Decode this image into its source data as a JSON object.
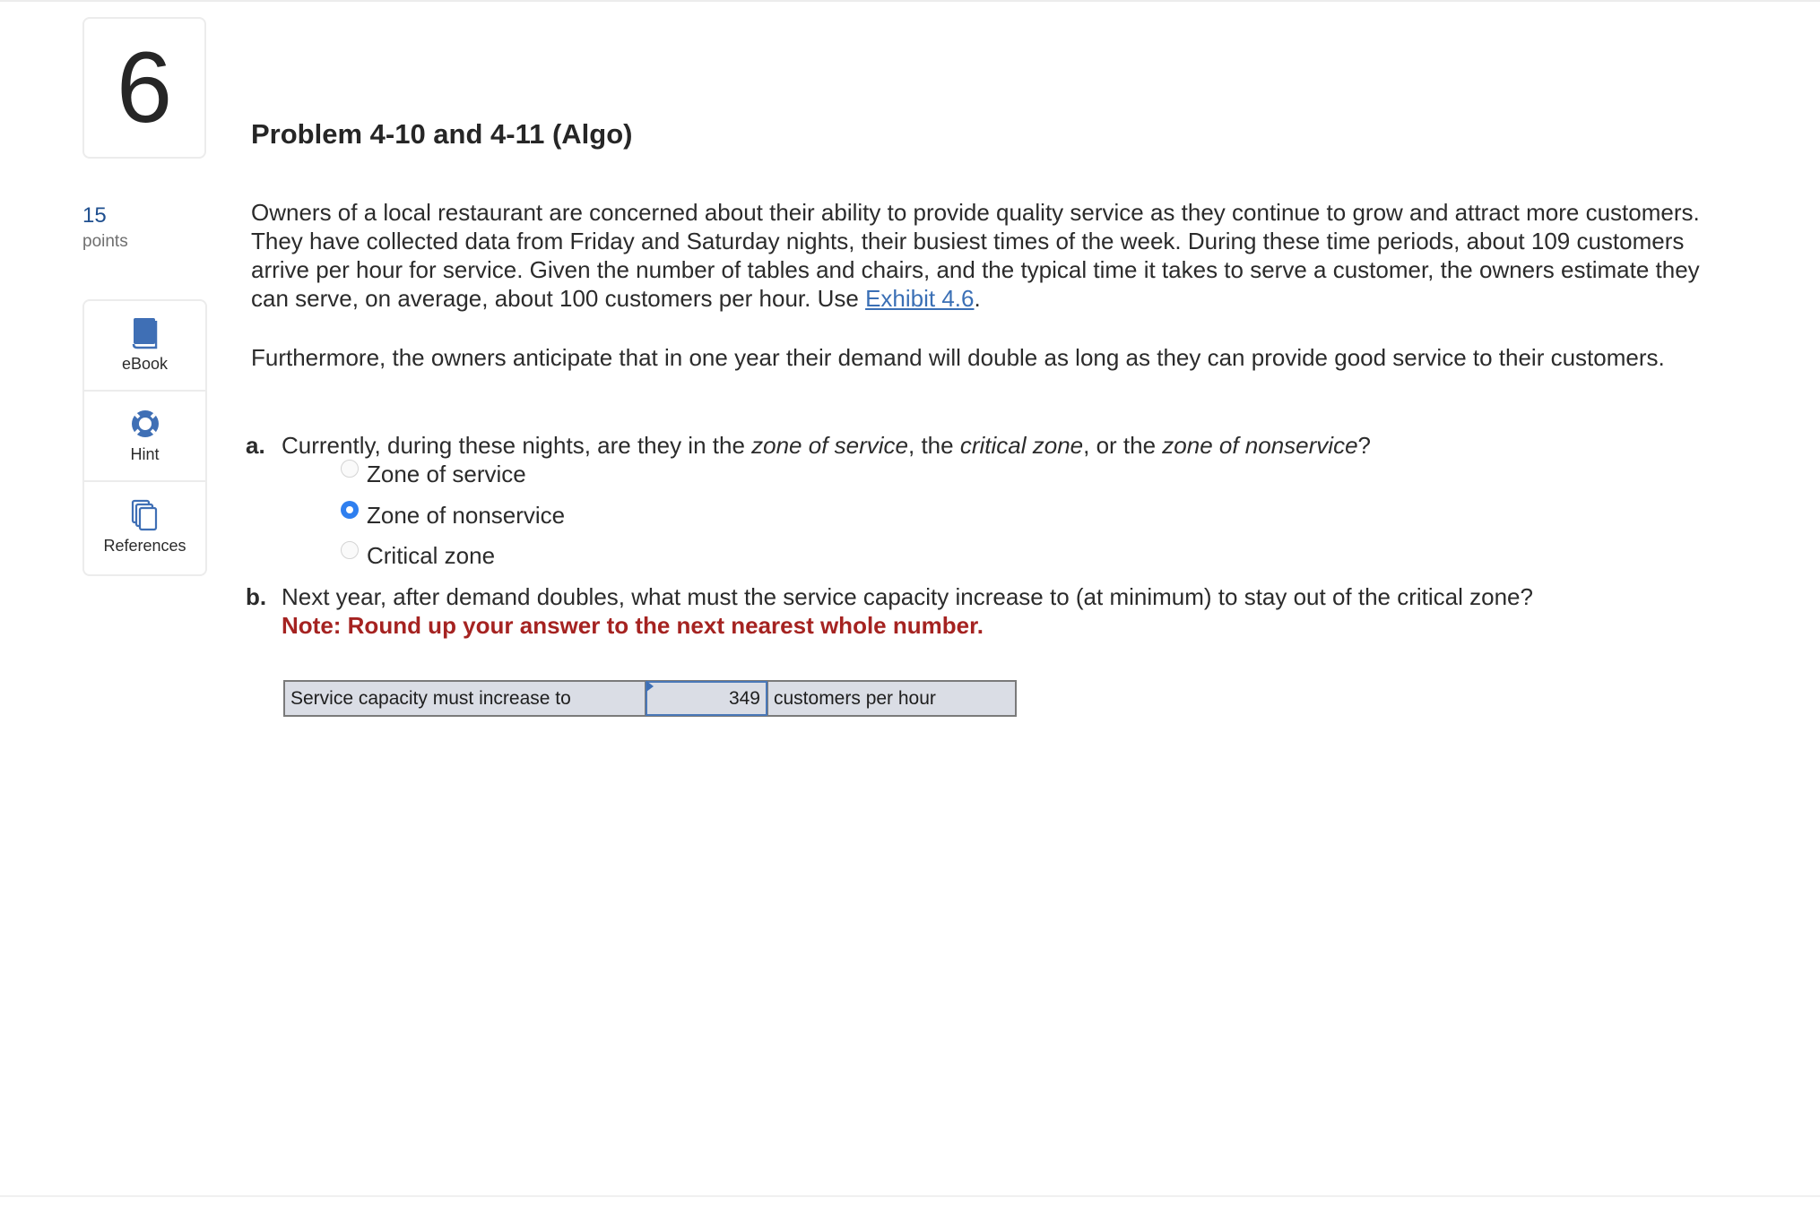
{
  "question": {
    "number": "6",
    "points_value": "15",
    "points_label": "points",
    "title": "Problem 4-10 and 4-11 (Algo)"
  },
  "tools": [
    {
      "label": "eBook",
      "icon": "book-icon"
    },
    {
      "label": "Hint",
      "icon": "lifebuoy-icon"
    },
    {
      "label": "References",
      "icon": "stacked-pages-icon"
    }
  ],
  "body": {
    "paragraph1_text": "Owners of a local restaurant are concerned about their ability to provide quality service as they continue to grow and attract more customers. They have collected data from Friday and Saturday nights, their busiest times of the week. During these time periods, about 109 customers arrive per hour for service. Given the number of tables and chairs, and the typical time it takes to serve a customer, the owners estimate they can serve, on average, about 100 customers per hour. Use ",
    "exhibit_link": "Exhibit 4.6",
    "paragraph1_end": ".",
    "paragraph2": "Furthermore, the owners anticipate that in one year their demand will double as long as they can provide good service to their customers."
  },
  "part_a": {
    "label": "a.",
    "text_1": "Currently, during these nights, are they in the ",
    "em_1": "zone of service",
    "text_2": ", the ",
    "em_2": "critical zone",
    "text_3": ", or the ",
    "em_3": "zone of nonservice",
    "text_4": "?",
    "options": [
      {
        "label": "Zone of service",
        "selected": false
      },
      {
        "label": "Zone of nonservice",
        "selected": true
      },
      {
        "label": "Critical zone",
        "selected": false
      }
    ]
  },
  "part_b": {
    "label": "b.",
    "text": "Next year, after demand doubles, what must the service capacity increase to (at minimum) to stay out of the critical zone?",
    "note": "Note: Round up your answer to the next nearest whole number.",
    "answer_row": {
      "prefix": "Service capacity must increase to",
      "value": "349",
      "suffix": "customers per hour"
    }
  },
  "colors": {
    "accent_blue": "#3a6fb5",
    "points_blue": "#1f4f8f",
    "note_red": "#a52321",
    "radio_selected": "#2f7fef",
    "answer_table_bg": "#dadde5"
  }
}
